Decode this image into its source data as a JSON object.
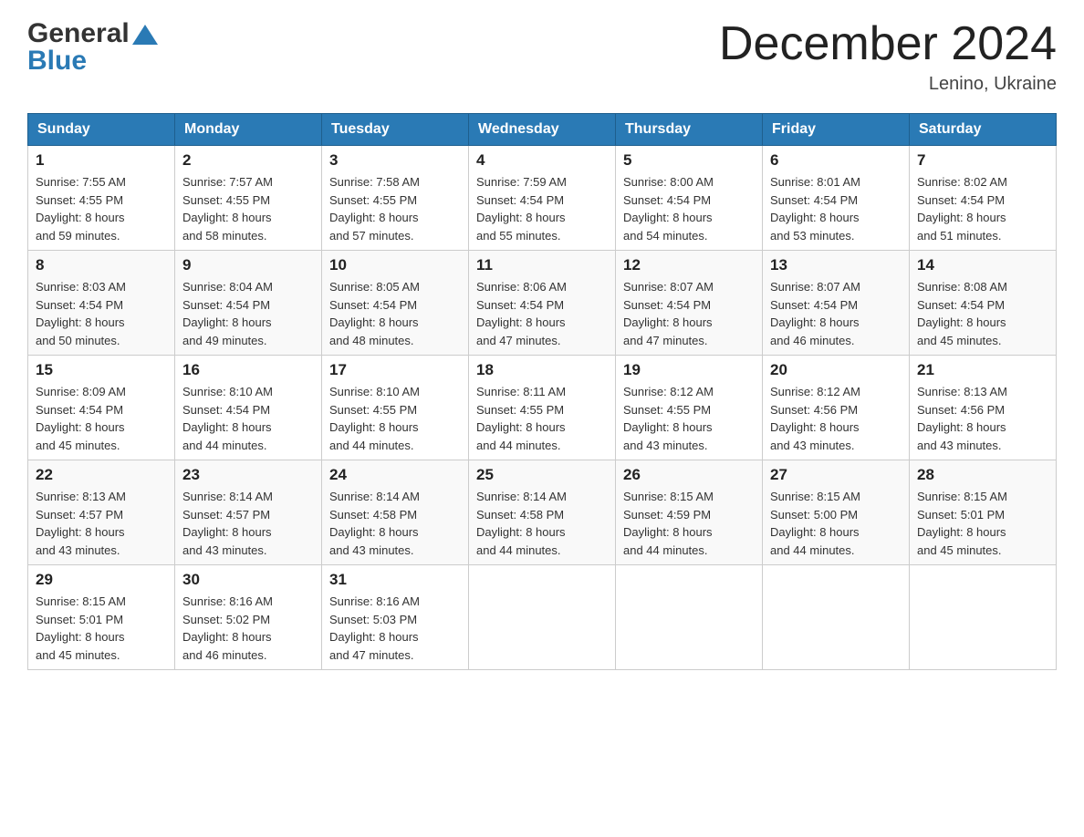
{
  "header": {
    "month_title": "December 2024",
    "location": "Lenino, Ukraine"
  },
  "logo": {
    "general": "General",
    "blue": "Blue"
  },
  "days_of_week": [
    "Sunday",
    "Monday",
    "Tuesday",
    "Wednesday",
    "Thursday",
    "Friday",
    "Saturday"
  ],
  "weeks": [
    [
      {
        "day": "1",
        "sunrise": "7:55 AM",
        "sunset": "4:55 PM",
        "daylight": "8 hours and 59 minutes."
      },
      {
        "day": "2",
        "sunrise": "7:57 AM",
        "sunset": "4:55 PM",
        "daylight": "8 hours and 58 minutes."
      },
      {
        "day": "3",
        "sunrise": "7:58 AM",
        "sunset": "4:55 PM",
        "daylight": "8 hours and 57 minutes."
      },
      {
        "day": "4",
        "sunrise": "7:59 AM",
        "sunset": "4:54 PM",
        "daylight": "8 hours and 55 minutes."
      },
      {
        "day": "5",
        "sunrise": "8:00 AM",
        "sunset": "4:54 PM",
        "daylight": "8 hours and 54 minutes."
      },
      {
        "day": "6",
        "sunrise": "8:01 AM",
        "sunset": "4:54 PM",
        "daylight": "8 hours and 53 minutes."
      },
      {
        "day": "7",
        "sunrise": "8:02 AM",
        "sunset": "4:54 PM",
        "daylight": "8 hours and 51 minutes."
      }
    ],
    [
      {
        "day": "8",
        "sunrise": "8:03 AM",
        "sunset": "4:54 PM",
        "daylight": "8 hours and 50 minutes."
      },
      {
        "day": "9",
        "sunrise": "8:04 AM",
        "sunset": "4:54 PM",
        "daylight": "8 hours and 49 minutes."
      },
      {
        "day": "10",
        "sunrise": "8:05 AM",
        "sunset": "4:54 PM",
        "daylight": "8 hours and 48 minutes."
      },
      {
        "day": "11",
        "sunrise": "8:06 AM",
        "sunset": "4:54 PM",
        "daylight": "8 hours and 47 minutes."
      },
      {
        "day": "12",
        "sunrise": "8:07 AM",
        "sunset": "4:54 PM",
        "daylight": "8 hours and 47 minutes."
      },
      {
        "day": "13",
        "sunrise": "8:07 AM",
        "sunset": "4:54 PM",
        "daylight": "8 hours and 46 minutes."
      },
      {
        "day": "14",
        "sunrise": "8:08 AM",
        "sunset": "4:54 PM",
        "daylight": "8 hours and 45 minutes."
      }
    ],
    [
      {
        "day": "15",
        "sunrise": "8:09 AM",
        "sunset": "4:54 PM",
        "daylight": "8 hours and 45 minutes."
      },
      {
        "day": "16",
        "sunrise": "8:10 AM",
        "sunset": "4:54 PM",
        "daylight": "8 hours and 44 minutes."
      },
      {
        "day": "17",
        "sunrise": "8:10 AM",
        "sunset": "4:55 PM",
        "daylight": "8 hours and 44 minutes."
      },
      {
        "day": "18",
        "sunrise": "8:11 AM",
        "sunset": "4:55 PM",
        "daylight": "8 hours and 44 minutes."
      },
      {
        "day": "19",
        "sunrise": "8:12 AM",
        "sunset": "4:55 PM",
        "daylight": "8 hours and 43 minutes."
      },
      {
        "day": "20",
        "sunrise": "8:12 AM",
        "sunset": "4:56 PM",
        "daylight": "8 hours and 43 minutes."
      },
      {
        "day": "21",
        "sunrise": "8:13 AM",
        "sunset": "4:56 PM",
        "daylight": "8 hours and 43 minutes."
      }
    ],
    [
      {
        "day": "22",
        "sunrise": "8:13 AM",
        "sunset": "4:57 PM",
        "daylight": "8 hours and 43 minutes."
      },
      {
        "day": "23",
        "sunrise": "8:14 AM",
        "sunset": "4:57 PM",
        "daylight": "8 hours and 43 minutes."
      },
      {
        "day": "24",
        "sunrise": "8:14 AM",
        "sunset": "4:58 PM",
        "daylight": "8 hours and 43 minutes."
      },
      {
        "day": "25",
        "sunrise": "8:14 AM",
        "sunset": "4:58 PM",
        "daylight": "8 hours and 44 minutes."
      },
      {
        "day": "26",
        "sunrise": "8:15 AM",
        "sunset": "4:59 PM",
        "daylight": "8 hours and 44 minutes."
      },
      {
        "day": "27",
        "sunrise": "8:15 AM",
        "sunset": "5:00 PM",
        "daylight": "8 hours and 44 minutes."
      },
      {
        "day": "28",
        "sunrise": "8:15 AM",
        "sunset": "5:01 PM",
        "daylight": "8 hours and 45 minutes."
      }
    ],
    [
      {
        "day": "29",
        "sunrise": "8:15 AM",
        "sunset": "5:01 PM",
        "daylight": "8 hours and 45 minutes."
      },
      {
        "day": "30",
        "sunrise": "8:16 AM",
        "sunset": "5:02 PM",
        "daylight": "8 hours and 46 minutes."
      },
      {
        "day": "31",
        "sunrise": "8:16 AM",
        "sunset": "5:03 PM",
        "daylight": "8 hours and 47 minutes."
      },
      null,
      null,
      null,
      null
    ]
  ],
  "labels": {
    "sunrise": "Sunrise: ",
    "sunset": "Sunset: ",
    "daylight": "Daylight: "
  },
  "colors": {
    "header_bg": "#2a7ab5",
    "header_text": "#ffffff"
  }
}
